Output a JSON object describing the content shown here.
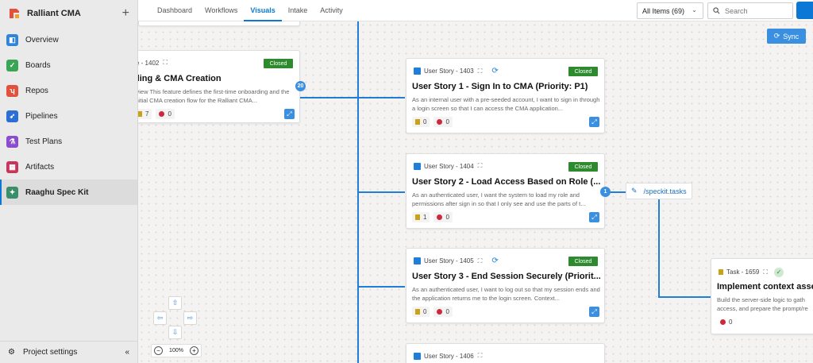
{
  "sidebar": {
    "org_name": "Ralliant CMA",
    "items": [
      {
        "label": "Overview",
        "icon": "overview-icon",
        "color": "#2f86d8"
      },
      {
        "label": "Boards",
        "icon": "boards-icon",
        "color": "#3aa655"
      },
      {
        "label": "Repos",
        "icon": "repos-icon",
        "color": "#e2513b"
      },
      {
        "label": "Pipelines",
        "icon": "pipelines-icon",
        "color": "#2b6fd4"
      },
      {
        "label": "Test Plans",
        "icon": "test-plans-icon",
        "color": "#8b4ccf"
      },
      {
        "label": "Artifacts",
        "icon": "artifacts-icon",
        "color": "#c8355a"
      },
      {
        "label": "Raaghu Spec Kit",
        "icon": "spec-kit-icon",
        "color": "#3a8f6a"
      }
    ],
    "footer_label": "Project settings"
  },
  "topnav": {
    "tabs": [
      "Dashboard",
      "Workflows",
      "Visuals",
      "Intake",
      "Activity"
    ],
    "active_tab": "Visuals",
    "filter_label": "All Items (69)",
    "search_placeholder": "Search"
  },
  "sync_label": "Sync",
  "feature_card": {
    "id_text": "e - 1402",
    "status": "Closed",
    "title": "ding & CMA Creation",
    "desc": "rview This feature defines the first-time onboarding and the initial CMA creation flow for the Ralliant CMA...",
    "tasks": "7",
    "bugs": "0",
    "badge": "20"
  },
  "cards": [
    {
      "id_text": "User Story - 1403",
      "status": "Closed",
      "title": "User Story 1 - Sign In to CMA (Priority: P1)",
      "desc": "As an internal user with a pre-seeded account, I want to sign in through a login screen so that I can access the CMA application...",
      "tasks": "0",
      "bugs": "0"
    },
    {
      "id_text": "User Story - 1404",
      "status": "Closed",
      "title": "User Story 2 - Load Access Based on Role (...",
      "desc": "As an authenticated user, I want the system to load my role and permissions after sign in so that I only see and use the parts of t...",
      "tasks": "1",
      "bugs": "0",
      "badge": "1"
    },
    {
      "id_text": "User Story - 1405",
      "status": "Closed",
      "title": "User Story 3 - End Session Securely (Priorit...",
      "desc": "As an authenticated user, I want to log out so that my session ends and the application returns me to the login screen. Context...",
      "tasks": "0",
      "bugs": "0"
    },
    {
      "id_text": "User Story - 1406"
    }
  ],
  "speckit_label": "/speckit.tasks",
  "task_card": {
    "id_text": "Task - 1659",
    "title": "Implement context assen",
    "desc": "Build the server-side logic to gath access, and prepare the prompt/re",
    "bugs": "0"
  },
  "zoom_level": "100%",
  "colors": {
    "accent": "#0a78d4",
    "closed": "#2e8a2e",
    "connector": "#1f7fd8"
  }
}
